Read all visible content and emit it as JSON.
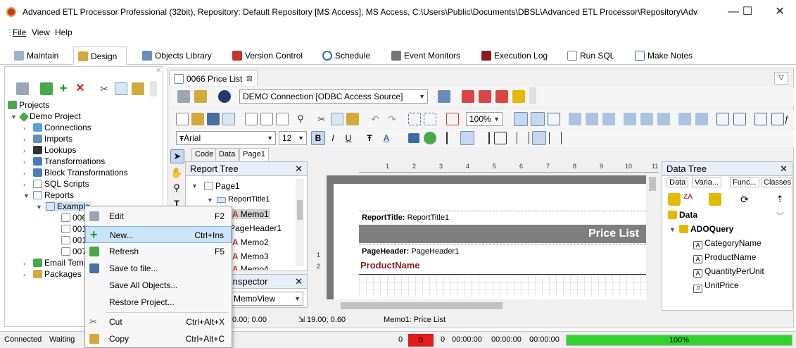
{
  "window": {
    "title": "Advanced ETL Processor Professional (32bit), Repository: Default Repository  [MS Access], MS Access, C:\\Users\\Public\\Documents\\DBSL\\Advanced ETL Processor\\Repository\\Advan...",
    "minimize": "—",
    "maximize": "☐",
    "close": "✕"
  },
  "menu": {
    "file": "File",
    "view": "View",
    "help": "Help"
  },
  "main_tabs": [
    "Maintain",
    "Design",
    "Objects Library",
    "Version Control",
    "Schedule",
    "Event Monitors",
    "Execution Log",
    "Run SQL",
    "Make Notes"
  ],
  "tree": {
    "root": "Projects",
    "project": "Demo Project",
    "children": [
      "Connections",
      "Imports",
      "Lookups",
      "Transformations",
      "Block Transformations",
      "SQL Scripts",
      "Reports"
    ],
    "report_folder": "Example",
    "reports": [
      "006",
      "001",
      "001",
      "007"
    ],
    "after": [
      "Email Temp",
      "Packages"
    ]
  },
  "document_tab": "0066 Price List",
  "connection": "DEMO Connection [ODBC Access Source]",
  "zoom": "100%",
  "font": {
    "name": "Arial",
    "size": "12",
    "bold": "B",
    "italic": "I",
    "underline": "U"
  },
  "sub_tabs": [
    "Code",
    "Data",
    "Page1"
  ],
  "report_tree": {
    "title": "Report Tree",
    "items": [
      "Page1",
      "ReportTitle1",
      "Memo1",
      "PageHeader1",
      "Memo2",
      "Memo3",
      "Memo4"
    ]
  },
  "inspector": {
    "title": "Inspector",
    "value": "MemoView"
  },
  "design": {
    "report_title_band_label": "ReportTitle:",
    "report_title_band_name": "ReportTitle1",
    "price_list": "Price List",
    "page_header_band_label": "PageHeader:",
    "page_header_band_name": "PageHeader1",
    "product_name": "ProductName",
    "ruler": [
      "1",
      "2",
      "3",
      "4",
      "5",
      "6",
      "7",
      "8",
      "9",
      "10",
      "11"
    ],
    "vruler": [
      "1",
      "2"
    ]
  },
  "position": {
    "pos": "0.00; 0.00",
    "size": "19.00; 0.60",
    "memo": "Memo1: Price List"
  },
  "data_tree": {
    "title": "Data Tree",
    "tabs": [
      "Data",
      "Varia...",
      "Func...",
      "Classes"
    ],
    "root": "Data",
    "query": "ADOQuery",
    "fields": [
      "CategoryName",
      "ProductName",
      "QuantityPerUnit",
      "UnitPrice"
    ]
  },
  "context_menu": [
    {
      "label": "Edit",
      "shortcut": "F2"
    },
    {
      "label": "New...",
      "shortcut": "Ctrl+Ins"
    },
    {
      "label": "Refresh",
      "shortcut": "F5"
    },
    {
      "label": "Save to file...",
      "shortcut": ""
    },
    {
      "label": "Save All Objects...",
      "shortcut": ""
    },
    {
      "label": "Restore Project...",
      "shortcut": ""
    },
    {
      "label": "Cut",
      "shortcut": "Ctrl+Alt+X"
    },
    {
      "label": "Copy",
      "shortcut": "Ctrl+Alt+C"
    }
  ],
  "status": {
    "connected": "Connected",
    "waiting": "Waiting",
    "n1": "0",
    "n2": "0",
    "n3": "0",
    "t1": "00:00:00",
    "t2": "00:00:00",
    "t3": "00:00:00",
    "t4": "00:00:00",
    "progress_text": "100%",
    "progress_value": 100
  },
  "colors": {
    "accent": "#3c6ca8",
    "progress": "#31d42f",
    "error": "#e31b1b",
    "band_dark": "#7f7f7f",
    "field_red": "#8b1a1a"
  }
}
